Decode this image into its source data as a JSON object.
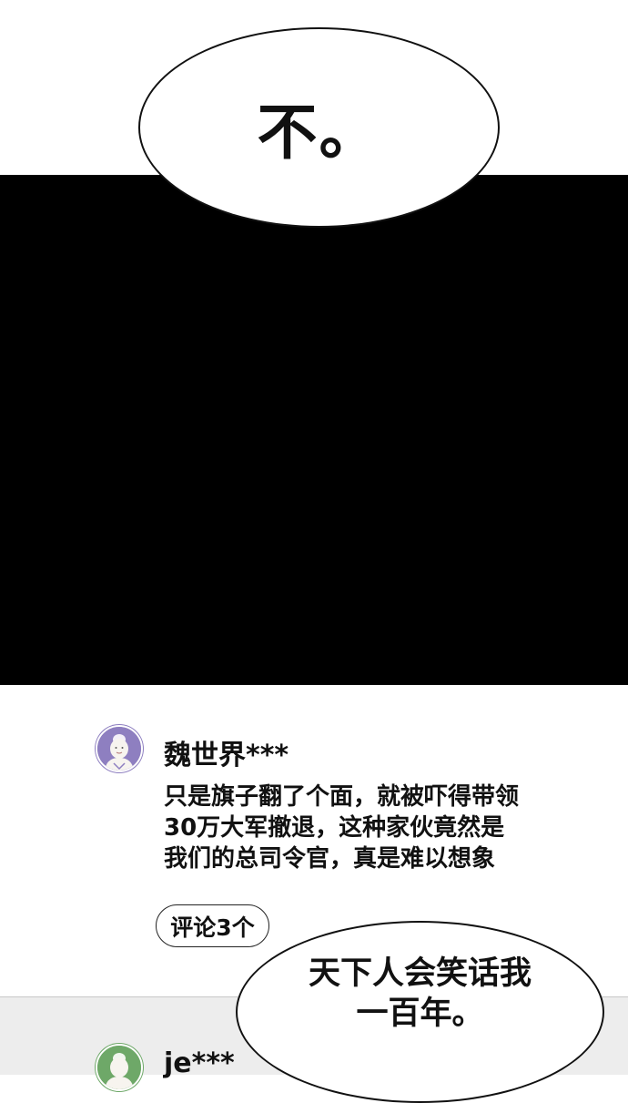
{
  "panels": {
    "bubble_top_text": "不。",
    "bubble_bottom_lines": [
      "天下人会笑话我",
      "一百年。"
    ]
  },
  "comments": [
    {
      "username": "魏世界***",
      "text_lines": [
        "只是旗子翻了个面，就被吓得带领",
        "30万大军撤退，这种家伙竟然是",
        "我们的总司令官，真是难以想象"
      ],
      "reply_label": "评论3个",
      "avatar_color": "#8e7fc0"
    },
    {
      "username": "je***",
      "avatar_color": "#6ea868"
    }
  ],
  "colors": {
    "panel_black": "#000000",
    "comment_bg_alt": "#ededed"
  }
}
